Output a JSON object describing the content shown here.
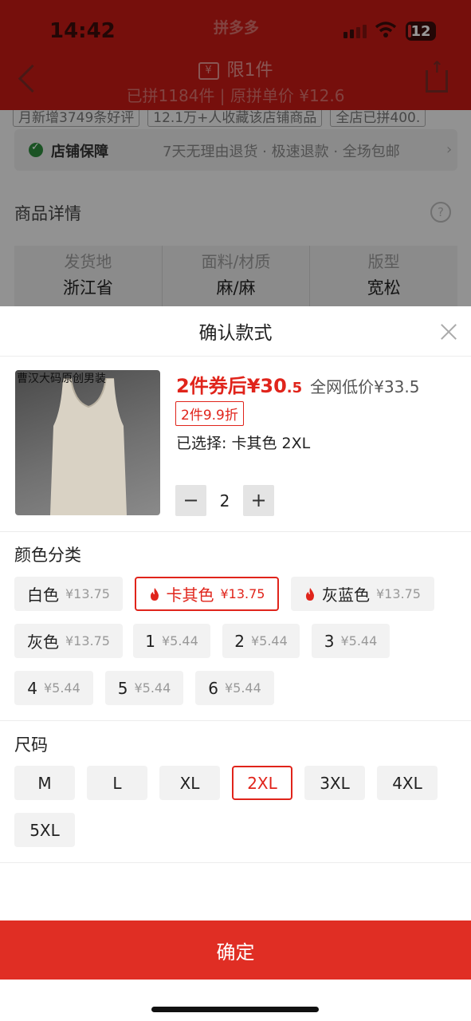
{
  "status_bar": {
    "time": "14:42",
    "app": "拼多多",
    "battery": "12"
  },
  "header": {
    "limit": "限1件",
    "coupon_icon": "¥",
    "sold": "已拼1184件 | 原拼单价 ¥12.6"
  },
  "background": {
    "tags": [
      "月新增3749条好评",
      "12.1万+人收藏该店铺商品",
      "全店已拼400."
    ],
    "guarantee_title": "店铺保障",
    "guarantee_text": "7天无理由退货 · 极速退款 · 全场包邮",
    "detail_title": "商品详情",
    "attrs": [
      {
        "key": "发货地",
        "value": "浙江省"
      },
      {
        "key": "面料/材质",
        "value": "麻/麻"
      },
      {
        "key": "版型",
        "value": "宽松"
      }
    ]
  },
  "sheet": {
    "title": "确认款式",
    "product_image_text": "曹汉大码原创男装",
    "price_prefix": "2件券后¥30",
    "price_decimal": ".5",
    "ref_price": "全网低价¥33.5",
    "discount": "2件9.9折",
    "selected": "已选择: 卡其色 2XL",
    "quantity": "2",
    "minus": "−",
    "plus": "+",
    "color_label": "颜色分类",
    "colors": [
      {
        "name": "白色",
        "price": "¥13.75",
        "hot": false,
        "selected": false
      },
      {
        "name": "卡其色",
        "price": "¥13.75",
        "hot": true,
        "selected": true
      },
      {
        "name": "灰蓝色",
        "price": "¥13.75",
        "hot": true,
        "selected": false
      },
      {
        "name": "灰色",
        "price": "¥13.75",
        "hot": false,
        "selected": false
      },
      {
        "name": "1",
        "price": "¥5.44",
        "hot": false,
        "selected": false
      },
      {
        "name": "2",
        "price": "¥5.44",
        "hot": false,
        "selected": false
      },
      {
        "name": "3",
        "price": "¥5.44",
        "hot": false,
        "selected": false
      },
      {
        "name": "4",
        "price": "¥5.44",
        "hot": false,
        "selected": false
      },
      {
        "name": "5",
        "price": "¥5.44",
        "hot": false,
        "selected": false
      },
      {
        "name": "6",
        "price": "¥5.44",
        "hot": false,
        "selected": false
      }
    ],
    "size_label": "尺码",
    "sizes": [
      "M",
      "L",
      "XL",
      "2XL",
      "3XL",
      "4XL",
      "5XL"
    ],
    "selected_size": "2XL",
    "confirm": "确定"
  },
  "colors_theme": {
    "accent": "#e0241b",
    "header_red": "#c51a15",
    "confirm_red": "#e02e24"
  }
}
